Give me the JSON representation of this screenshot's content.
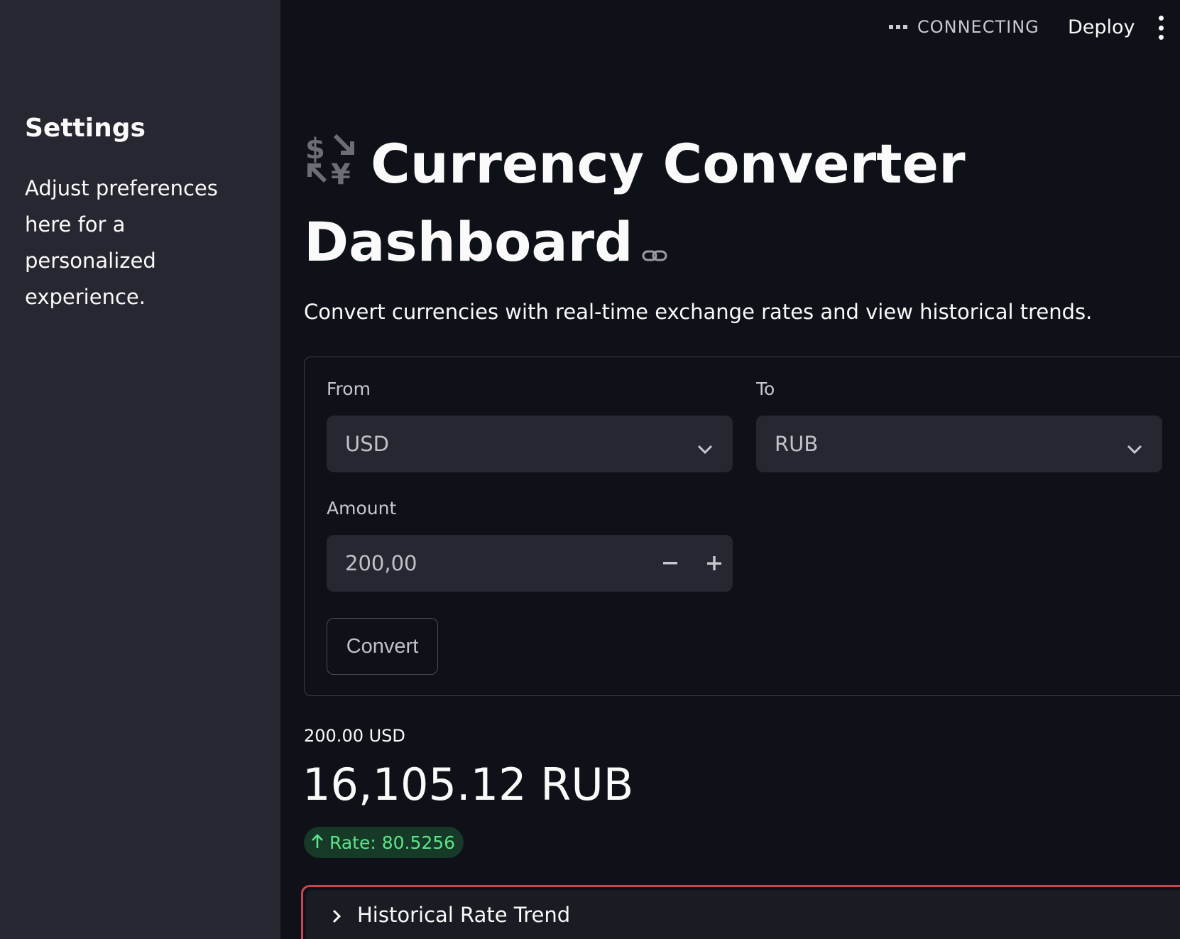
{
  "sidebar": {
    "title": "Settings",
    "text": "Adjust preferences here for a personalized experience."
  },
  "header": {
    "status": "CONNECTING",
    "deploy_label": "Deploy"
  },
  "main": {
    "title": "Currency Converter Dashboard",
    "subtitle": "Convert currencies with real-time exchange rates and view historical trends."
  },
  "form": {
    "from_label": "From",
    "from_value": "USD",
    "to_label": "To",
    "to_value": "RUB",
    "amount_label": "Amount",
    "amount_value": "200,00",
    "convert_label": "Convert"
  },
  "result": {
    "input_amount": "200.00 USD",
    "output_amount": "16,105.12 RUB",
    "rate": "Rate: 80.5256"
  },
  "expander": {
    "label": "Historical Rate Trend"
  },
  "colors": {
    "background": "#0e1117",
    "sidebar": "#262730",
    "delta_green": "#5ce488",
    "expander_border": "#c8474f"
  }
}
